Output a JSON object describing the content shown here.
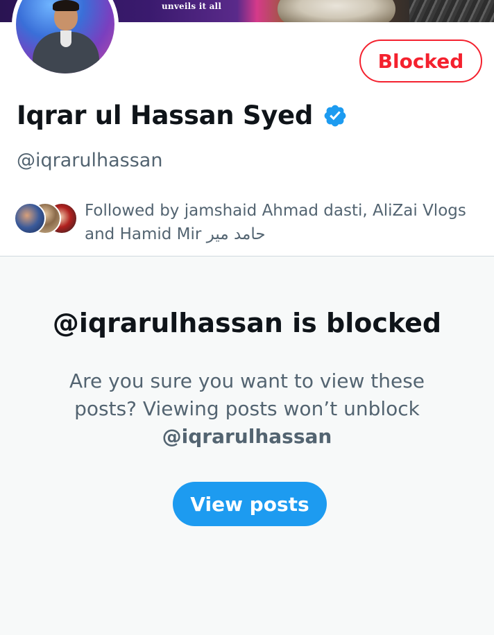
{
  "banner": {
    "caption": "unveils it all"
  },
  "profile": {
    "display_name": "Iqrar ul Hassan Syed",
    "handle": "@iqrarulhassan",
    "verified": true,
    "blocked_label": "Blocked",
    "followed_by": "Followed by jamshaid Ahmad dasti, AliZai Vlogs and Hamid Mir حامد میر"
  },
  "blocked_notice": {
    "title": "@iqrarulhassan is blocked",
    "description": "Are you sure you want to view these posts? Viewing posts won’t unblock",
    "handle": "@iqrarulhassan",
    "view_button": "View posts"
  },
  "colors": {
    "blocked_red": "#f4212e",
    "accent_blue": "#1d9bf0",
    "secondary_text": "#536471"
  }
}
